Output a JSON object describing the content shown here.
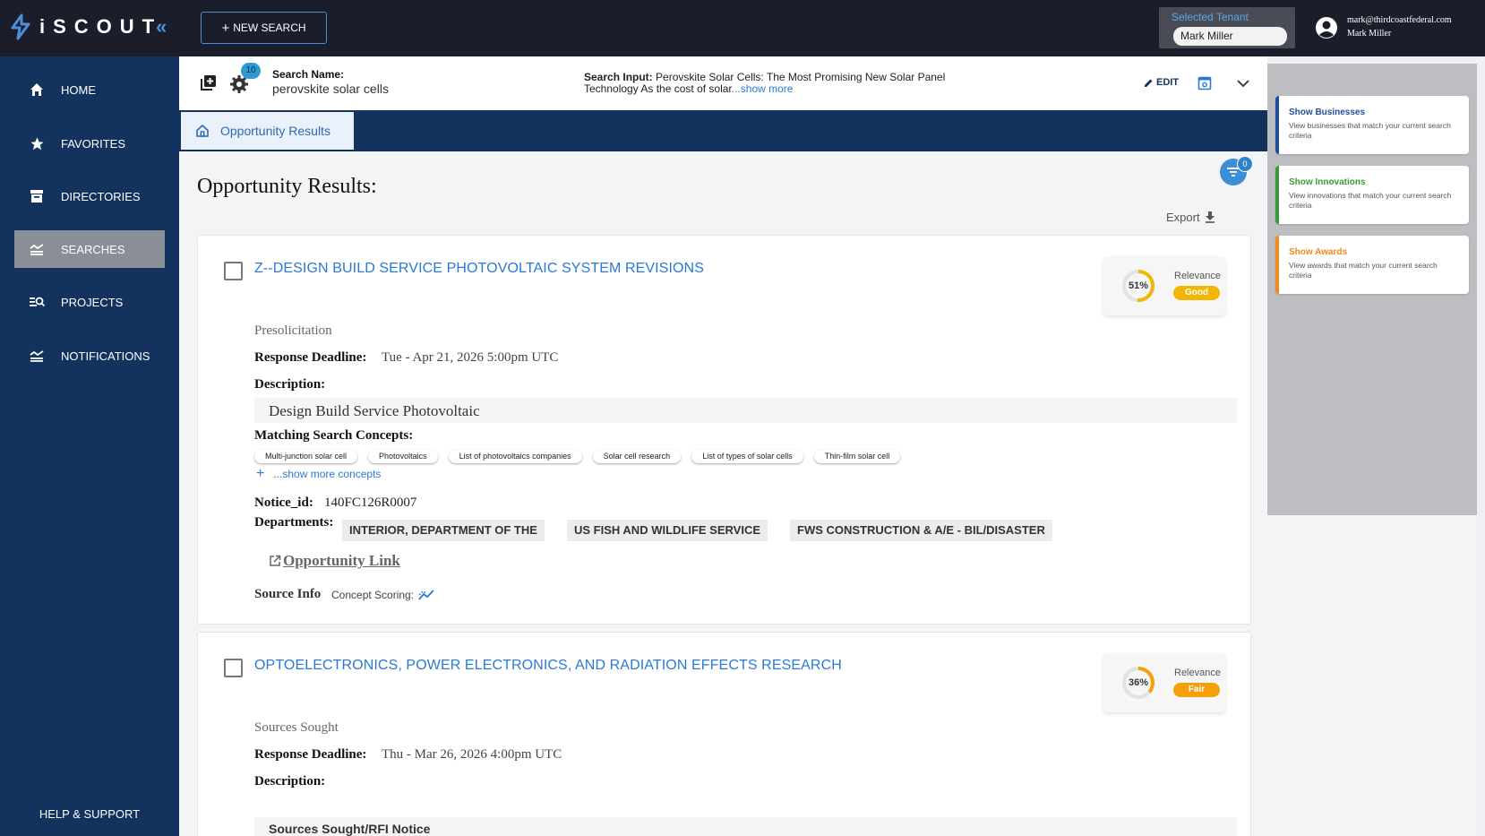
{
  "app": {
    "name": "iSCOUT",
    "collapse_glyph": "«"
  },
  "topbar": {
    "new_search_label": "NEW SEARCH",
    "tenant_label": "Selected Tenant",
    "tenant_value": "Mark Miller",
    "user_email": "mark@thirdcoastfederal.com",
    "user_name": "Mark Miller"
  },
  "sidebar": {
    "items": [
      {
        "label": "HOME",
        "icon": "home-icon"
      },
      {
        "label": "FAVORITES",
        "icon": "star-icon"
      },
      {
        "label": "DIRECTORIES",
        "icon": "archive-icon"
      },
      {
        "label": "SEARCHES",
        "icon": "searches-icon",
        "active": true
      },
      {
        "label": "PROJECTS",
        "icon": "manage-search-icon"
      },
      {
        "label": "NOTIFICATIONS",
        "icon": "notifications-icon"
      }
    ],
    "help_label": "HELP & SUPPORT"
  },
  "search_header": {
    "badge_count": "10",
    "name_label": "Search Name:",
    "name_value": "perovskite solar cells",
    "input_label": "Search Input:",
    "input_value": "Perovskite Solar Cells: The Most Promising New Solar Panel Technology As the cost of solar",
    "show_more": "...show more",
    "edit_label": "EDIT"
  },
  "tab": {
    "label": "Opportunity Results"
  },
  "main": {
    "title": "Opportunity Results:",
    "filter_count": "0",
    "export_label": "Export"
  },
  "results": [
    {
      "title": "Z--DESIGN BUILD SERVICE PHOTOVOLTAIC SYSTEM REVISIONS",
      "relevance_pct": "51%",
      "relevance_value": 51,
      "relevance_label": "Relevance",
      "relevance_rating": "Good",
      "type": "Presolicitation",
      "deadline_label": "Response Deadline:",
      "deadline": "Tue - Apr 21, 2026 5:00pm UTC",
      "description_label": "Description:",
      "description": "Design Build Service Photovoltaic",
      "concepts_label": "Matching Search Concepts:",
      "concepts": [
        "Multi-junction solar cell",
        "Photovoltaics",
        "List of photovoltaics companies",
        "Solar cell research",
        "List of types of solar cells",
        "Thin-film solar cell"
      ],
      "more_concepts": "...show more concepts",
      "notice_label": "Notice_id:",
      "notice_id": "140FC126R0007",
      "departments_label": "Departments:",
      "departments": [
        "INTERIOR, DEPARTMENT OF THE",
        "US FISH AND WILDLIFE SERVICE",
        "FWS CONSTRUCTION & A/E - BIL/DISASTER"
      ],
      "link_label": "Opportunity Link",
      "source_label": "Source Info",
      "scoring_label": "Concept Scoring:"
    },
    {
      "title": "OPTOELECTRONICS, POWER ELECTRONICS, AND RADIATION EFFECTS RESEARCH",
      "relevance_pct": "36%",
      "relevance_value": 36,
      "relevance_label": "Relevance",
      "relevance_rating": "Fair",
      "type": "Sources Sought",
      "deadline_label": "Response Deadline:",
      "deadline": "Thu - Mar 26, 2026 4:00pm UTC",
      "description_label": "Description:",
      "description": "Sources Sought/RFI Notice"
    }
  ],
  "right_panel": [
    {
      "title": "Show Businesses",
      "desc": "View businesses that match your current search criteria",
      "color": "#1f4f9c"
    },
    {
      "title": "Show Innovations",
      "desc": "View innovations that match your current search criteria",
      "color": "#3a9a3a"
    },
    {
      "title": "Show Awards",
      "desc": "View awards that match your current search criteria",
      "color": "#f08a1c"
    }
  ],
  "colors": {
    "good": "#f2b705",
    "fair": "#f5a00a",
    "sidebar": "#13325e",
    "topbar": "#1b1d2a",
    "link": "#2a7ad4"
  }
}
